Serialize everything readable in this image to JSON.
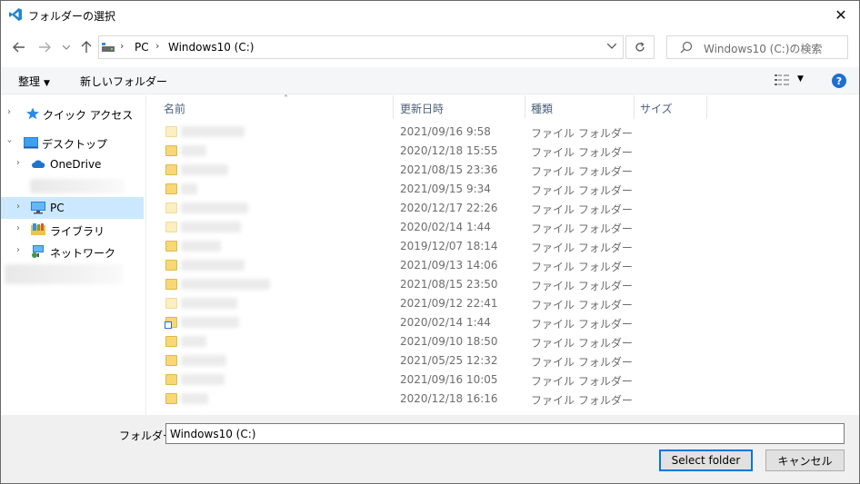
{
  "window": {
    "title": "フォルダーの選択",
    "close_glyph": "✕"
  },
  "address": {
    "crumbs": [
      "PC",
      "Windows10 (C:)"
    ]
  },
  "search": {
    "placeholder": "Windows10 (C:)の検索"
  },
  "toolbar": {
    "organize_label": "整理",
    "new_folder_label": "新しいフォルダー",
    "help_label": "?"
  },
  "nav": {
    "items": [
      {
        "label": "クイック アクセス",
        "icon": "star-icon"
      },
      {
        "label": "デスクトップ",
        "icon": "desktop-icon"
      },
      {
        "label": "OneDrive",
        "icon": "cloud-icon"
      },
      {
        "label": "PC",
        "icon": "pc-icon",
        "selected": true
      },
      {
        "label": "ライブラリ",
        "icon": "library-icon"
      },
      {
        "label": "ネットワーク",
        "icon": "network-icon"
      }
    ]
  },
  "columns": {
    "name": "名前",
    "date": "更新日時",
    "type": "種類",
    "size": "サイズ"
  },
  "rows": [
    {
      "date": "2021/09/16 9:58",
      "type": "ファイル フォルダー",
      "style": "pale"
    },
    {
      "date": "2020/12/18 15:55",
      "type": "ファイル フォルダー",
      "style": "normal"
    },
    {
      "date": "2021/08/15 23:36",
      "type": "ファイル フォルダー",
      "style": "normal"
    },
    {
      "date": "2021/09/15 9:34",
      "type": "ファイル フォルダー",
      "style": "normal"
    },
    {
      "date": "2020/12/17 22:26",
      "type": "ファイル フォルダー",
      "style": "pale"
    },
    {
      "date": "2020/02/14 1:44",
      "type": "ファイル フォルダー",
      "style": "pale"
    },
    {
      "date": "2019/12/07 18:14",
      "type": "ファイル フォルダー",
      "style": "normal"
    },
    {
      "date": "2021/09/13 14:06",
      "type": "ファイル フォルダー",
      "style": "normal"
    },
    {
      "date": "2021/08/15 23:50",
      "type": "ファイル フォルダー",
      "style": "normal"
    },
    {
      "date": "2021/09/12 22:41",
      "type": "ファイル フォルダー",
      "style": "pale"
    },
    {
      "date": "2020/02/14 1:44",
      "type": "ファイル フォルダー",
      "style": "shortcut"
    },
    {
      "date": "2021/09/10 18:50",
      "type": "ファイル フォルダー",
      "style": "normal"
    },
    {
      "date": "2021/05/25 12:32",
      "type": "ファイル フォルダー",
      "style": "normal"
    },
    {
      "date": "2021/09/16 10:05",
      "type": "ファイル フォルダー",
      "style": "normal"
    },
    {
      "date": "2020/12/18 16:16",
      "type": "ファイル フォルダー",
      "style": "normal"
    }
  ],
  "footer": {
    "folder_label": "フォルダー:",
    "folder_value": "Windows10 (C:)",
    "select_button": "Select folder",
    "cancel_button": "キャンセル"
  }
}
